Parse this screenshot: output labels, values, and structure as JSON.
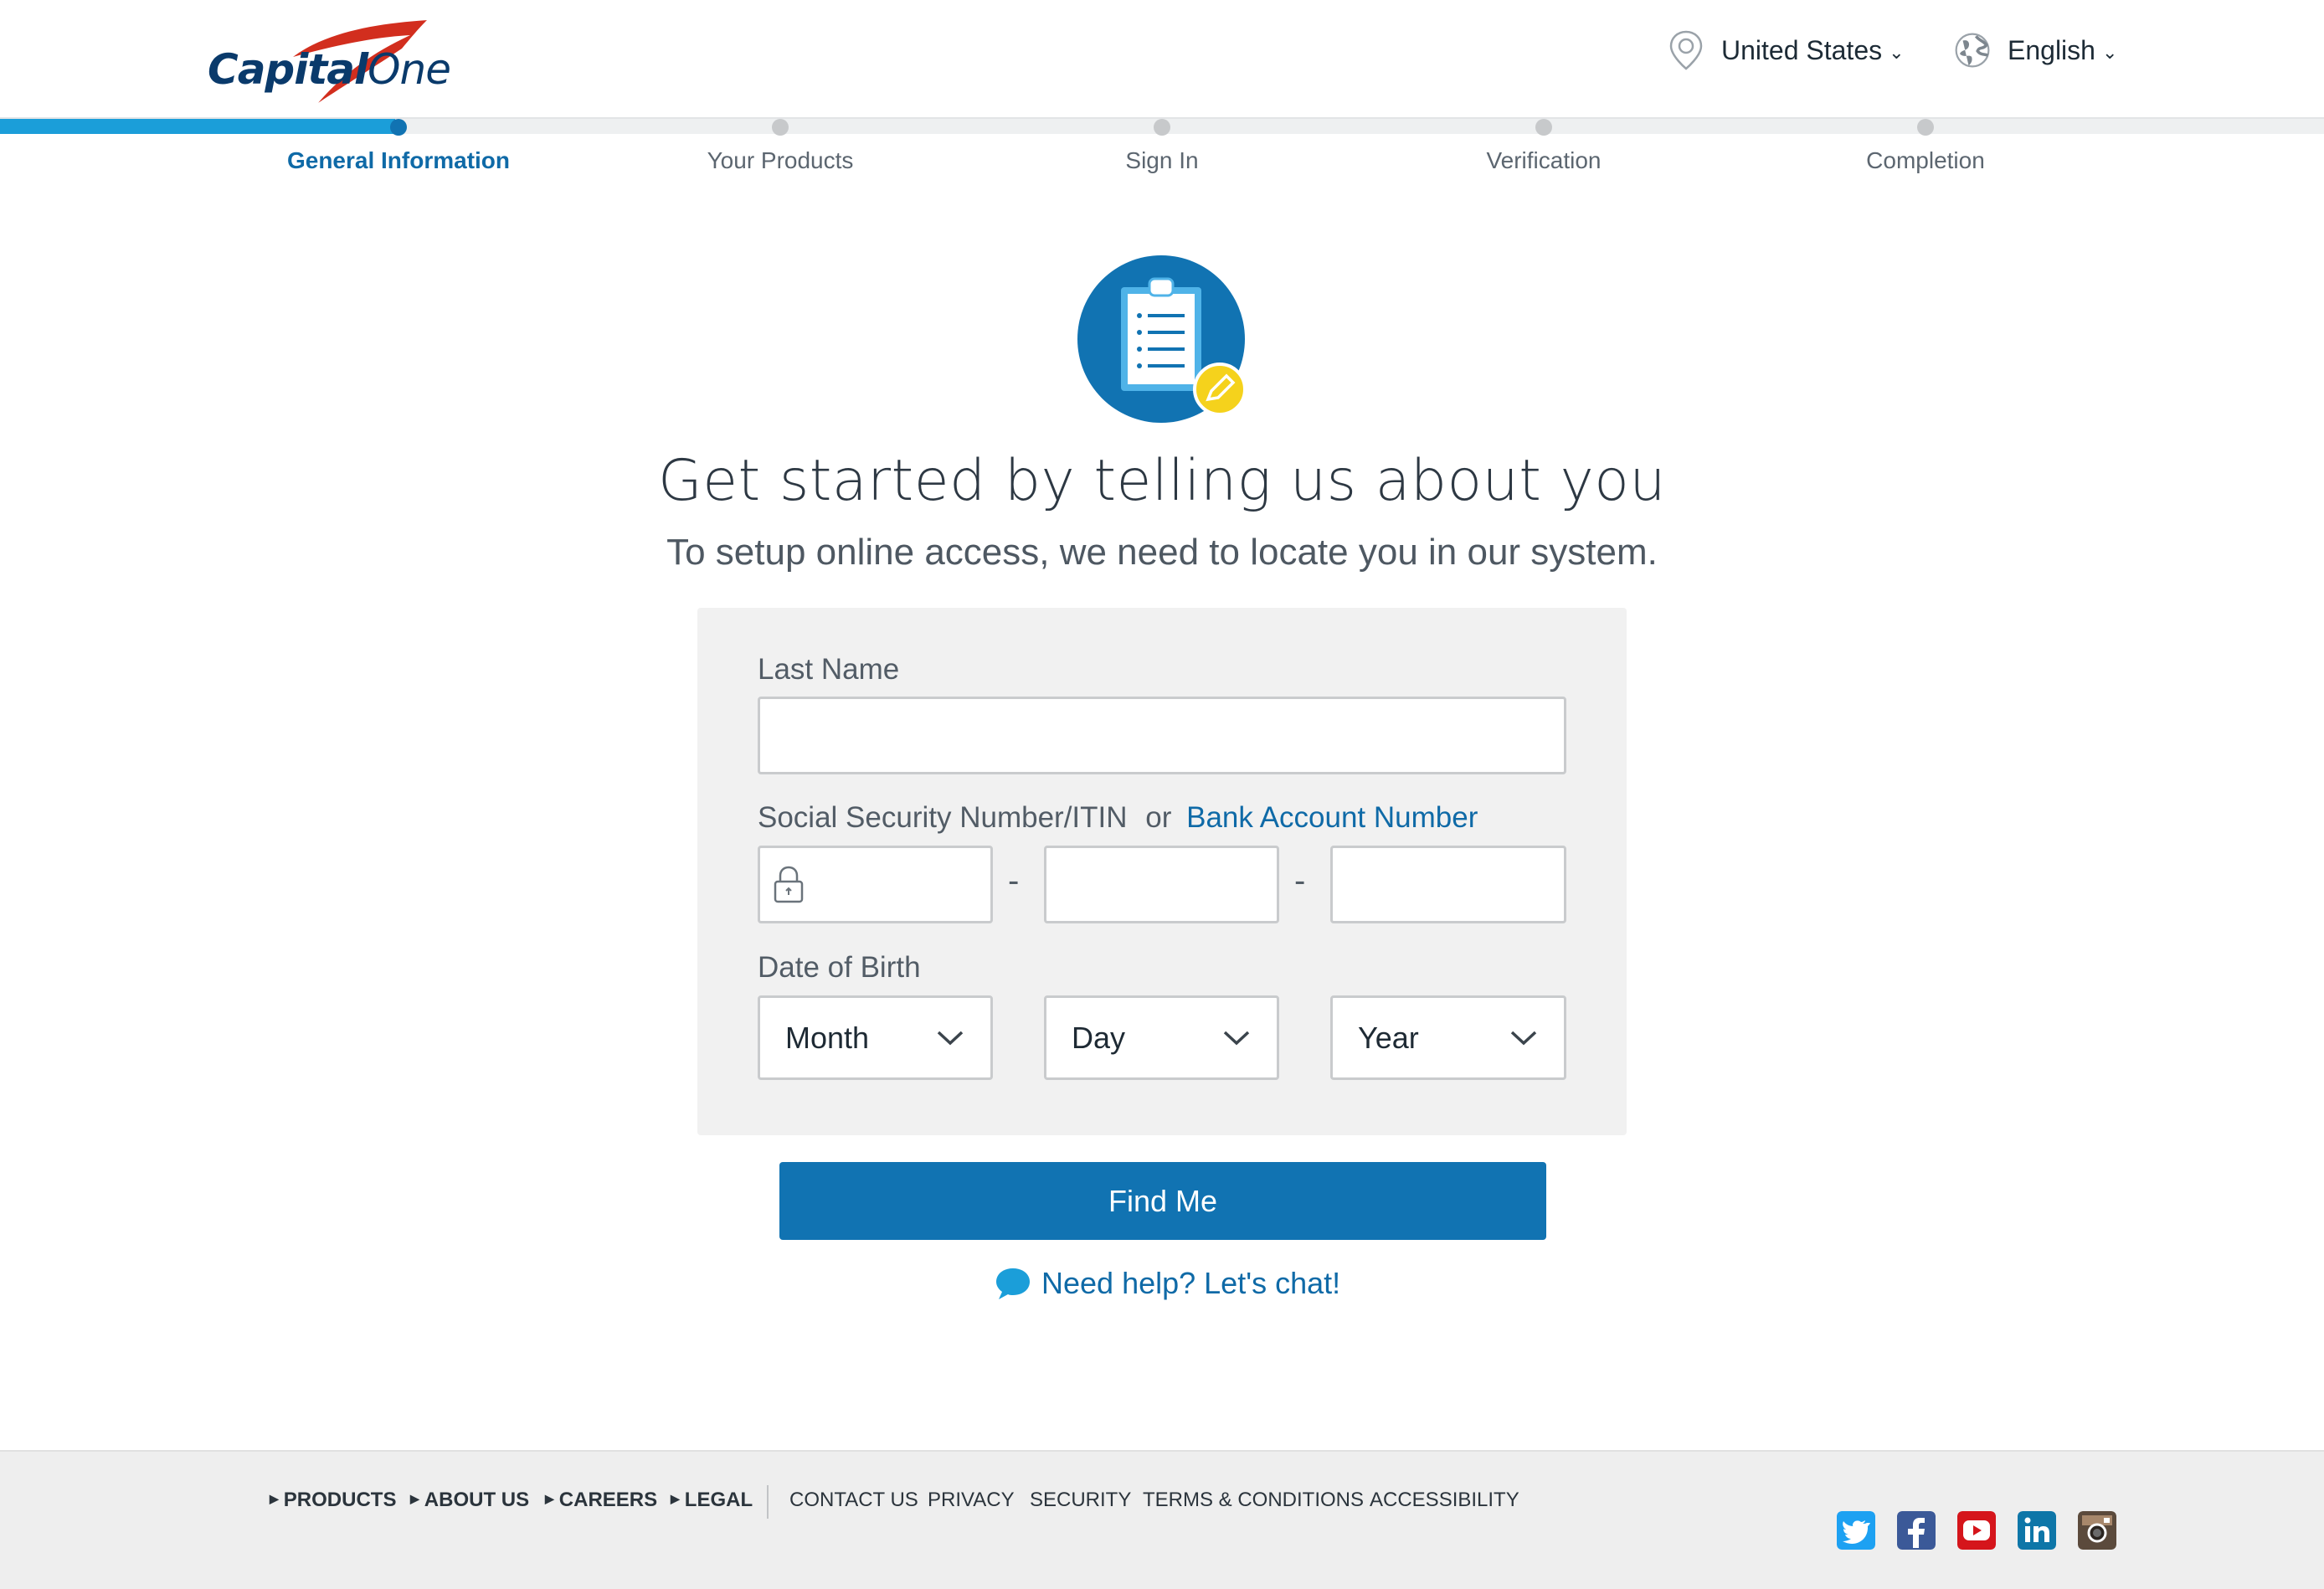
{
  "header": {
    "brand": "Capital One",
    "country": "United States",
    "language": "English"
  },
  "progress": {
    "completed_fraction": 0.17,
    "steps": [
      {
        "label": "General Information",
        "active": true
      },
      {
        "label": "Your Products",
        "active": false
      },
      {
        "label": "Sign In",
        "active": false
      },
      {
        "label": "Verification",
        "active": false
      },
      {
        "label": "Completion",
        "active": false
      }
    ]
  },
  "hero": {
    "icon": "clipboard-pencil-icon",
    "title": "Get started by telling us about you",
    "subtitle": "To setup online access, we need to locate you in our system."
  },
  "form": {
    "last_name_label": "Last Name",
    "last_name_value": "",
    "ssn_label": "Social Security Number/ITIN",
    "ssn_or": "or",
    "ssn_alt_link": "Bank Account Number",
    "ssn_separator": "-",
    "dob_label": "Date of Birth",
    "month": "Month",
    "day": "Day",
    "year": "Year"
  },
  "actions": {
    "find_me": "Find Me",
    "help": "Need help? Let's chat!"
  },
  "footer": {
    "primary_links": [
      "PRODUCTS",
      "ABOUT US",
      "CAREERS",
      "LEGAL"
    ],
    "secondary_links": [
      "CONTACT US",
      "PRIVACY",
      "SECURITY",
      "TERMS & CONDITIONS",
      "ACCESSIBILITY"
    ],
    "social": [
      "twitter-icon",
      "facebook-icon",
      "youtube-icon",
      "linkedin-icon",
      "instagram-icon"
    ]
  },
  "colors": {
    "brand_blue": "#1173b2",
    "progress_blue": "#1b9ed9",
    "accent_yellow": "#f5d21c"
  }
}
